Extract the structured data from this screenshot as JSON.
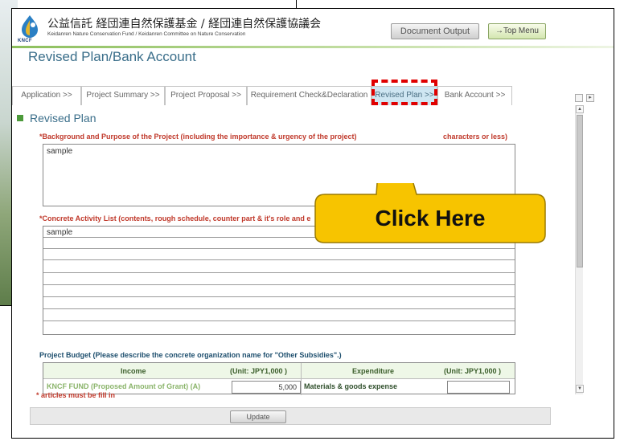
{
  "header": {
    "org_name_jp": "公益信託 経団連自然保護基金 / 経団連自然保護協議会",
    "org_name_en": "Keidanren Nature Conservation Fund / Keidanren Committee on Nature Conservation",
    "logo_text": "KNCF",
    "document_output_label": "Document Output",
    "top_menu_label": "→Top Menu"
  },
  "page_title": "Revised Plan/Bank Account",
  "tabs": [
    {
      "label": "Application >>"
    },
    {
      "label": "Project Summary >>"
    },
    {
      "label": "Project Proposal >>"
    },
    {
      "label": "Requirement Check&Declaration"
    },
    {
      "label": "Revised Plan >>"
    },
    {
      "label": "Bank Account >>"
    }
  ],
  "section": {
    "title": "Revised Plan",
    "background_label": "*Background and Purpose of the Project (including the importance & urgency of the project)",
    "background_label_tail": "characters or less)",
    "background_value": "sample",
    "activity_label": "*Concrete Activity List  (contents, rough schedule, counter part & it's role and e",
    "activity_first_value": "sample"
  },
  "budget": {
    "label": "Project Budget (Please describe the concrete organization name for \"Other Subsidies\".)",
    "head_income": "Income",
    "head_unit1": "(Unit: JPY1,000  )",
    "head_expenditure": "Expenditure",
    "head_unit2": "(Unit: JPY1,000  )",
    "row_kncf": "KNCF FUND (Proposed Amount of Grant) (A)",
    "row_amount": "5,000",
    "row_expenditure": "Materials & goods expense"
  },
  "articles_note": "* articles must be fill in",
  "update_label": "Update",
  "callout": {
    "text": "Click Here",
    "fill": "#f7c400"
  }
}
